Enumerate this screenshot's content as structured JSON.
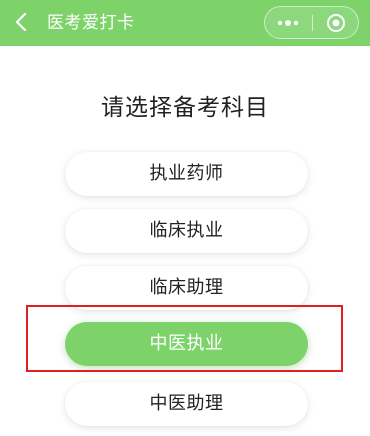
{
  "header": {
    "title": "医考爱打卡",
    "back_icon": "chevron-left-icon",
    "more_icon": "more-dots-icon",
    "close_icon": "target-close-icon",
    "background_color": "#7dd36a"
  },
  "main": {
    "heading": "请选择备考科目",
    "options": [
      {
        "label": "执业药师",
        "selected": false
      },
      {
        "label": "临床执业",
        "selected": false
      },
      {
        "label": "临床助理",
        "selected": false
      },
      {
        "label": "中医执业",
        "selected": true
      },
      {
        "label": "中医助理",
        "selected": false
      }
    ],
    "accent_color": "#7dd36a",
    "highlight_color": "#e02020"
  }
}
